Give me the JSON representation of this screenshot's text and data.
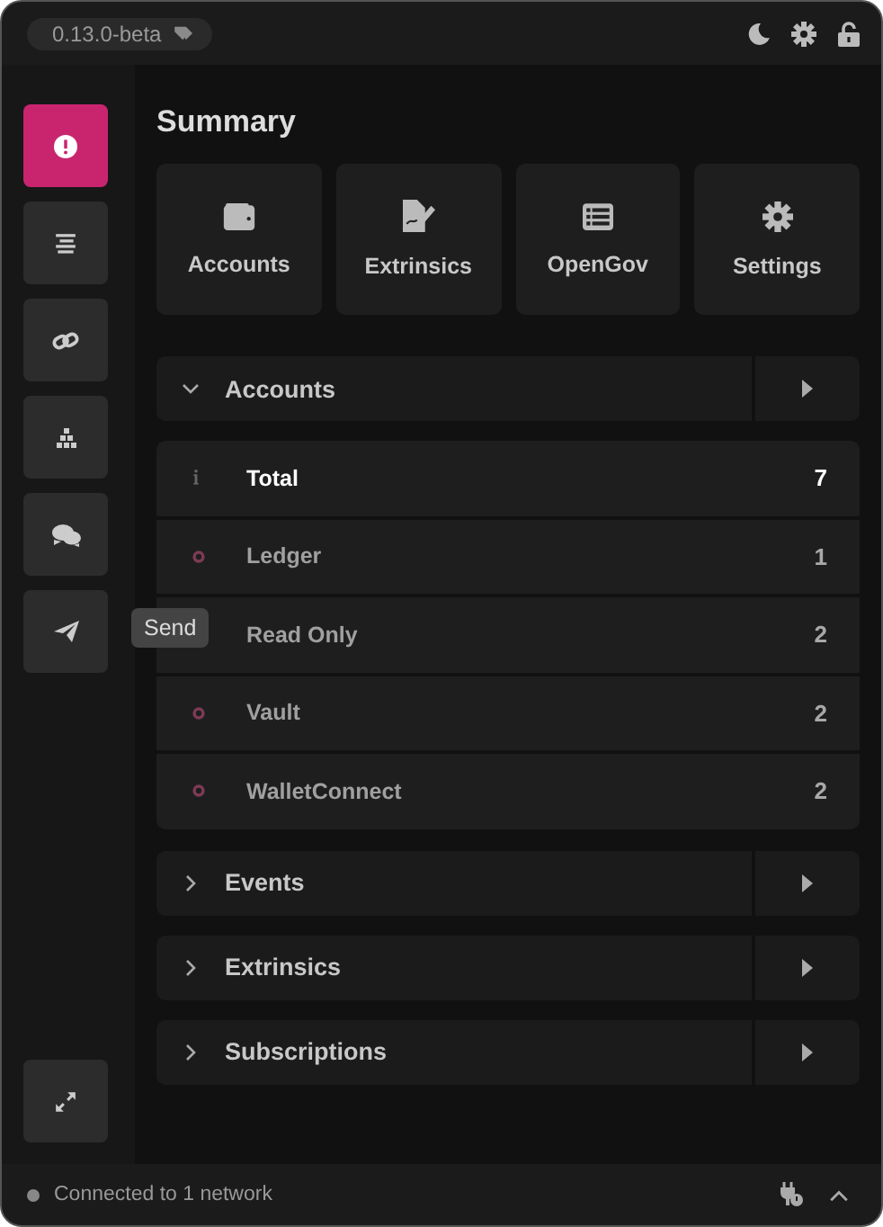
{
  "header": {
    "version": "0.13.0-beta"
  },
  "sidebar": {
    "items": [
      {
        "kind": "info",
        "selected": true
      },
      {
        "kind": "list",
        "selected": false
      },
      {
        "kind": "link",
        "selected": false
      },
      {
        "kind": "stack",
        "selected": false
      },
      {
        "kind": "chat",
        "selected": false
      },
      {
        "kind": "send",
        "selected": false,
        "tooltip": "Send"
      }
    ]
  },
  "summary": {
    "title": "Summary",
    "cards": [
      {
        "kind": "wallet",
        "label": "Accounts"
      },
      {
        "kind": "sign",
        "label": "Extrinsics"
      },
      {
        "kind": "table",
        "label": "OpenGov"
      },
      {
        "kind": "gear",
        "label": "Settings"
      }
    ],
    "sections": [
      {
        "title": "Accounts",
        "expanded": true,
        "rows": [
          {
            "kind": "total",
            "label": "Total",
            "count": "7"
          },
          {
            "kind": "group",
            "label": "Ledger",
            "count": "1"
          },
          {
            "kind": "plain",
            "label": "Read Only",
            "count": "2"
          },
          {
            "kind": "group",
            "label": "Vault",
            "count": "2"
          },
          {
            "kind": "group",
            "label": "WalletConnect",
            "count": "2"
          }
        ]
      },
      {
        "title": "Events",
        "expanded": false
      },
      {
        "title": "Extrinsics",
        "expanded": false
      },
      {
        "title": "Subscriptions",
        "expanded": false
      }
    ]
  },
  "status_bar": {
    "text": "Connected to 1 network"
  }
}
